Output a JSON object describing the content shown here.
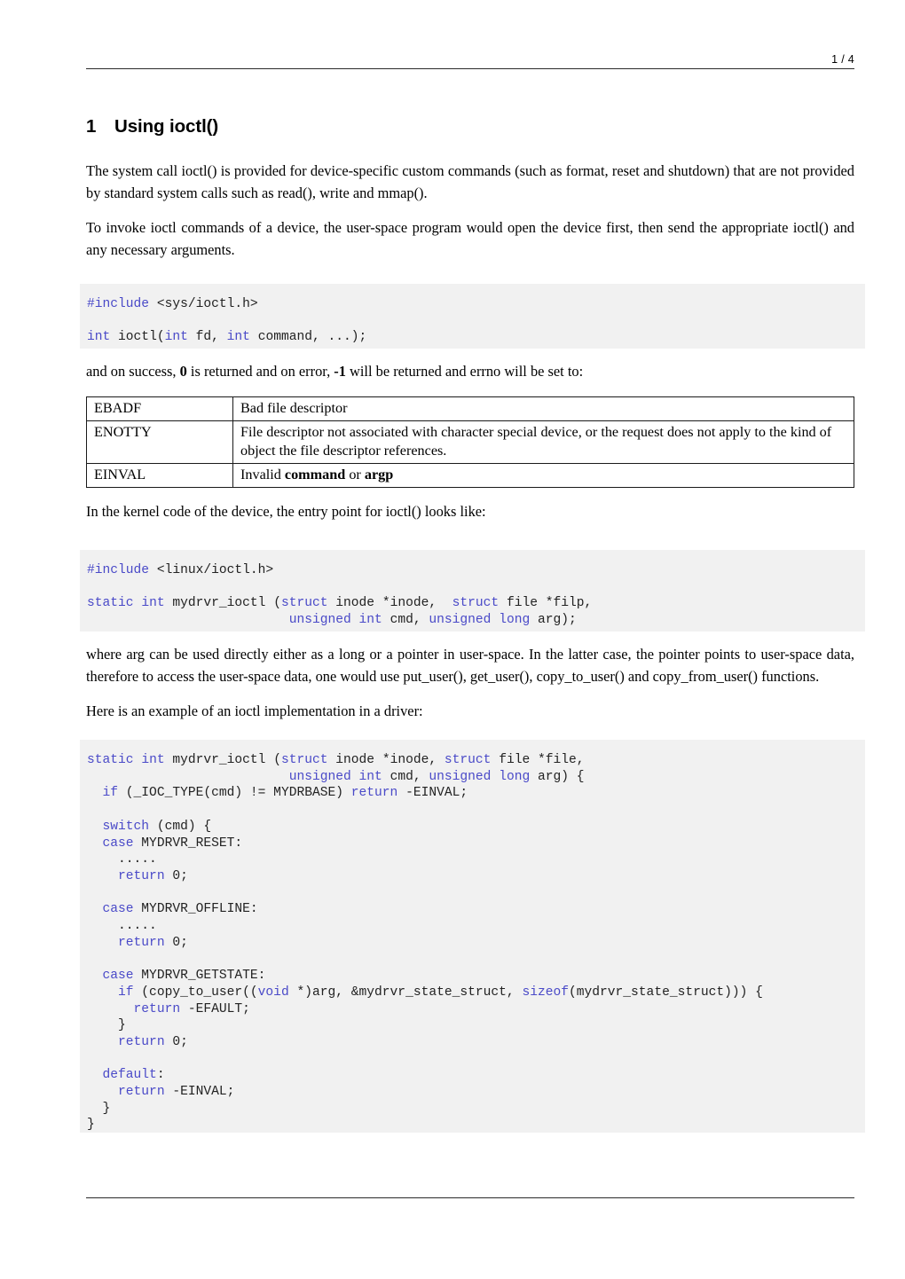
{
  "header": {
    "page_indicator": "1 / 4"
  },
  "title": {
    "number": "1",
    "text": "Using ioctl()"
  },
  "paragraphs": {
    "intro1": "The system call ioctl() is provided for device-specific custom commands (such as format, reset and shutdown) that are not provided by standard system calls such as read(), write and mmap().",
    "intro2": "To invoke ioctl commands of a device, the user-space program would open the device first, then send the appropriate ioctl() and any necessary arguments.",
    "after_code1_a": "and on success, ",
    "after_code1_b": "0",
    "after_code1_c": " is returned and on error, ",
    "after_code1_d": "-1",
    "after_code1_e": " will be returned and errno will be set to:",
    "kernel_entry": "In the kernel code of the device, the entry point for ioctl() looks like:",
    "arg_usage": "where arg can be used directly either as a long or a pointer in user-space. In the latter case, the pointer points to user-space data, therefore to access the user-space data, one would use put_user(), get_user(), copy_to_user() and copy_from_user() functions.",
    "example_lead": "Here is an example of an ioctl implementation in a driver:"
  },
  "code_block_1": {
    "lines": [
      [
        {
          "t": "#include",
          "k": true
        },
        {
          "t": " <sys/ioctl.h>",
          "k": false
        }
      ],
      [],
      [
        {
          "t": "int",
          "k": true
        },
        {
          "t": " ioctl(",
          "k": false
        },
        {
          "t": "int",
          "k": true
        },
        {
          "t": " fd, ",
          "k": false
        },
        {
          "t": "int",
          "k": true
        },
        {
          "t": " command, ...);",
          "k": false
        }
      ]
    ]
  },
  "code_block_2": {
    "lines": [
      [
        {
          "t": "#include",
          "k": true
        },
        {
          "t": " <linux/ioctl.h>",
          "k": false
        }
      ],
      [],
      [
        {
          "t": "static",
          "k": true
        },
        {
          "t": " ",
          "k": false
        },
        {
          "t": "int",
          "k": true
        },
        {
          "t": " mydrvr_ioctl (",
          "k": false
        },
        {
          "t": "struct",
          "k": true
        },
        {
          "t": " inode *inode,  ",
          "k": false
        },
        {
          "t": "struct",
          "k": true
        },
        {
          "t": " file *filp,",
          "k": false
        }
      ],
      [
        {
          "t": "                          ",
          "k": false
        },
        {
          "t": "unsigned",
          "k": true
        },
        {
          "t": " ",
          "k": false
        },
        {
          "t": "int",
          "k": true
        },
        {
          "t": " cmd, ",
          "k": false
        },
        {
          "t": "unsigned",
          "k": true
        },
        {
          "t": " ",
          "k": false
        },
        {
          "t": "long",
          "k": true
        },
        {
          "t": " arg);",
          "k": false
        }
      ]
    ]
  },
  "code_block_3": {
    "lines": [
      [
        {
          "t": "static",
          "k": true
        },
        {
          "t": " ",
          "k": false
        },
        {
          "t": "int",
          "k": true
        },
        {
          "t": " mydrvr_ioctl (",
          "k": false
        },
        {
          "t": "struct",
          "k": true
        },
        {
          "t": " inode *inode, ",
          "k": false
        },
        {
          "t": "struct",
          "k": true
        },
        {
          "t": " file *file,",
          "k": false
        }
      ],
      [
        {
          "t": "                          ",
          "k": false
        },
        {
          "t": "unsigned",
          "k": true
        },
        {
          "t": " ",
          "k": false
        },
        {
          "t": "int",
          "k": true
        },
        {
          "t": " cmd, ",
          "k": false
        },
        {
          "t": "unsigned",
          "k": true
        },
        {
          "t": " ",
          "k": false
        },
        {
          "t": "long",
          "k": true
        },
        {
          "t": " arg) {",
          "k": false
        }
      ],
      [
        {
          "t": "  ",
          "k": false
        },
        {
          "t": "if",
          "k": true
        },
        {
          "t": " (_IOC_TYPE(cmd) != MYDRBASE) ",
          "k": false
        },
        {
          "t": "return",
          "k": true
        },
        {
          "t": " -EINVAL;",
          "k": false
        }
      ],
      [],
      [
        {
          "t": "  ",
          "k": false
        },
        {
          "t": "switch",
          "k": true
        },
        {
          "t": " (cmd) {",
          "k": false
        }
      ],
      [
        {
          "t": "  ",
          "k": false
        },
        {
          "t": "case",
          "k": true
        },
        {
          "t": " MYDRVR_RESET:",
          "k": false
        }
      ],
      [
        {
          "t": "    .....",
          "k": false
        }
      ],
      [
        {
          "t": "    ",
          "k": false
        },
        {
          "t": "return",
          "k": true
        },
        {
          "t": " 0;",
          "k": false
        }
      ],
      [],
      [
        {
          "t": "  ",
          "k": false
        },
        {
          "t": "case",
          "k": true
        },
        {
          "t": " MYDRVR_OFFLINE:",
          "k": false
        }
      ],
      [
        {
          "t": "    .....",
          "k": false
        }
      ],
      [
        {
          "t": "    ",
          "k": false
        },
        {
          "t": "return",
          "k": true
        },
        {
          "t": " 0;",
          "k": false
        }
      ],
      [],
      [
        {
          "t": "  ",
          "k": false
        },
        {
          "t": "case",
          "k": true
        },
        {
          "t": " MYDRVR_GETSTATE:",
          "k": false
        }
      ],
      [
        {
          "t": "    ",
          "k": false
        },
        {
          "t": "if",
          "k": true
        },
        {
          "t": " (copy_to_user((",
          "k": false
        },
        {
          "t": "void",
          "k": true
        },
        {
          "t": " *)arg, &mydrvr_state_struct, ",
          "k": false
        },
        {
          "t": "sizeof",
          "k": true
        },
        {
          "t": "(mydrvr_state_struct))) {",
          "k": false
        }
      ],
      [
        {
          "t": "      ",
          "k": false
        },
        {
          "t": "return",
          "k": true
        },
        {
          "t": " -EFAULT;",
          "k": false
        }
      ],
      [
        {
          "t": "    }",
          "k": false
        }
      ],
      [
        {
          "t": "    ",
          "k": false
        },
        {
          "t": "return",
          "k": true
        },
        {
          "t": " 0;",
          "k": false
        }
      ],
      [],
      [
        {
          "t": "  ",
          "k": false
        },
        {
          "t": "default",
          "k": true
        },
        {
          "t": ":",
          "k": false
        }
      ],
      [
        {
          "t": "    ",
          "k": false
        },
        {
          "t": "return",
          "k": true
        },
        {
          "t": " -EINVAL;",
          "k": false
        }
      ],
      [
        {
          "t": "  }",
          "k": false
        }
      ],
      [
        {
          "t": "}",
          "k": false
        }
      ]
    ]
  },
  "error_table": {
    "rows": [
      {
        "code": "EBADF",
        "description_parts": [
          {
            "t": "Bad file descriptor",
            "b": false
          }
        ]
      },
      {
        "code": "ENOTTY",
        "description_parts": [
          {
            "t": "File descriptor not associated with character special device, or the request does not apply to the kind of object the file descriptor references.",
            "b": false
          }
        ]
      },
      {
        "code": "EINVAL",
        "description_parts": [
          {
            "t": "Invalid ",
            "b": false
          },
          {
            "t": "command",
            "b": true
          },
          {
            "t": " or ",
            "b": false
          },
          {
            "t": "argp",
            "b": true
          }
        ]
      }
    ]
  },
  "colors": {
    "keyword": "#4a4ac8",
    "code_background": "#f1f1f1",
    "rule": "#2b2b2b",
    "text": "#000000"
  }
}
